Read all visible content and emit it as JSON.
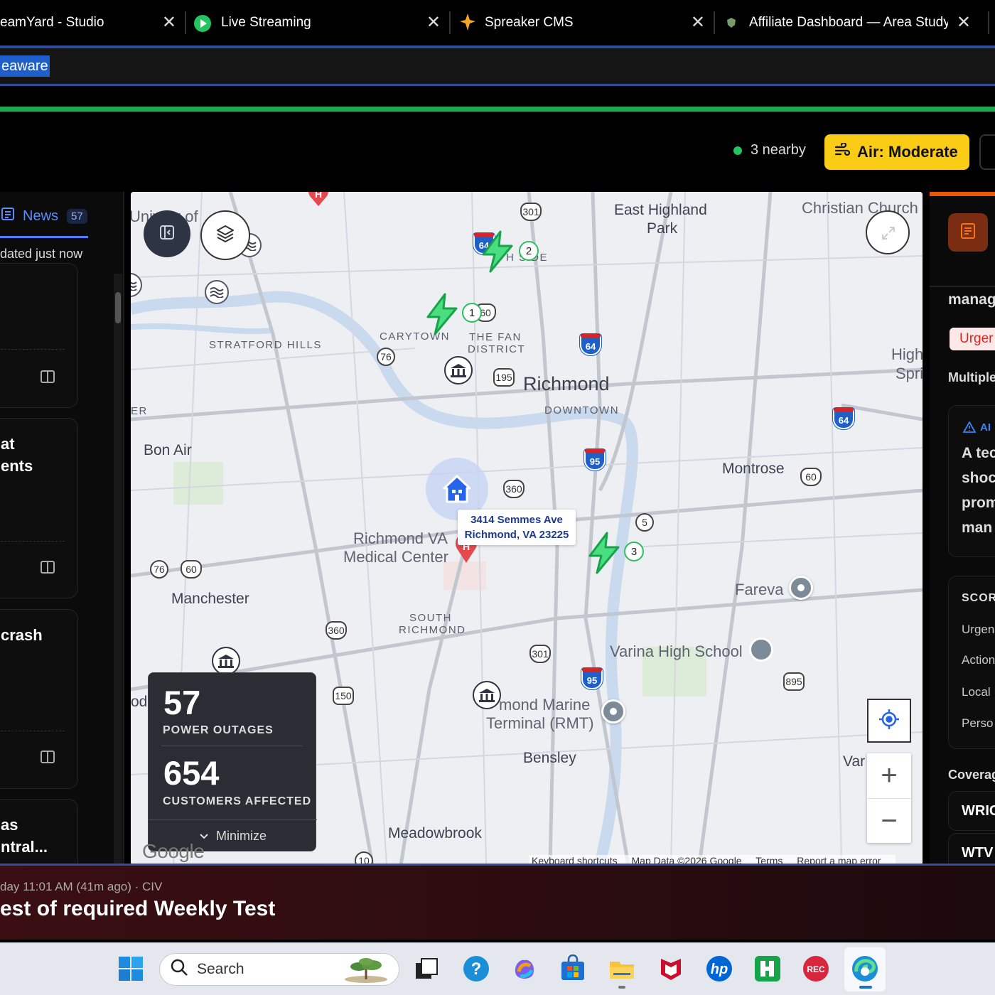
{
  "tabs": [
    {
      "title": "eamYard - Studio",
      "icon": "none"
    },
    {
      "title": "Live Streaming",
      "icon": "play-icon"
    },
    {
      "title": "Spreaker CMS",
      "icon": "star-icon"
    },
    {
      "title": "Affiliate Dashboard — Area Study",
      "icon": "shield-icon"
    }
  ],
  "address": {
    "selected_text": "eaware"
  },
  "header": {
    "nearby_text": "3 nearby",
    "air_button": "Air: Moderate",
    "colors": {
      "air": "#facc15",
      "nearby_dot": "#22c55e"
    }
  },
  "left": {
    "news_tab": "News",
    "news_count": "57",
    "updated": "dated just now",
    "cards": [
      {
        "title_lines": []
      },
      {
        "title_lines": [
          "at",
          "ents"
        ]
      },
      {
        "title_lines": [
          "crash"
        ]
      },
      {
        "title_lines": [
          "as",
          "ntral..."
        ]
      }
    ]
  },
  "map": {
    "places": {
      "east_highland_park_1": "East Highland",
      "east_highland_park_2": "Park",
      "christian_church": "Christian Church",
      "university": "Univ   ity of",
      "stratford_hills": "STRATFORD HILLS",
      "carytown": "CARYTOWN",
      "fan_district_1": "THE FAN",
      "fan_district_2": "DISTRICT",
      "richmond": "Richmond",
      "downtown": "DOWNTOWN",
      "high_springs_1": "High",
      "high_springs_2": "Spri",
      "er": "ER",
      "bon_air": "Bon Air",
      "montrose": "Montrose",
      "richmond_va_1": "Richmond VA",
      "richmond_va_2": "Medical Center",
      "manchester": "Manchester",
      "south_richmond_1": "SOUTH",
      "south_richmond_2": "RICHMOND",
      "fareva": "Fareva",
      "varina": "Varina High School",
      "marine_1": "mond Marine",
      "marine_2": "Terminal (RMT)",
      "bensley": "Bensley",
      "var": "Var",
      "meadowbrook": "Meadowbrook",
      "od": "od",
      "side": "H SIDE"
    },
    "address_line1": "3414 Semmes Ave",
    "address_line2": "Richmond, VA 23225",
    "routes": {
      "r301a": "301",
      "r64a": "64",
      "r60a": "60",
      "r76a": "76",
      "r195": "195",
      "r64b": "64",
      "r64c": "64",
      "r360a": "360",
      "r95a": "95",
      "r60b": "60",
      "r5": "5",
      "r76b": "76",
      "r60c": "60",
      "r360b": "360",
      "r301b": "301",
      "r95b": "95",
      "r895": "895",
      "r150": "150",
      "r10": "10"
    },
    "cluster_numbers": [
      "1",
      "2",
      "3"
    ],
    "outage": {
      "outages": "57",
      "outages_label": "POWER OUTAGES",
      "customers": "654",
      "customers_label": "CUSTOMERS AFFECTED",
      "minimize": "Minimize"
    },
    "google": "Google",
    "attribution": [
      "Keyboard shortcuts",
      "Map Data ©2026 Google",
      "Terms",
      "Report a map error"
    ]
  },
  "right": {
    "manag": "manag",
    "urgent": "Urger",
    "multiple": "Multiple",
    "ai_label": "AI",
    "ai_lines": [
      "A tec",
      "shoc",
      "prom",
      "man"
    ],
    "score_title": "SCOR",
    "score_items": [
      "Urgen",
      "Action",
      "Local",
      "Perso"
    ],
    "coverage": "Coverag",
    "stations": [
      "WRIC",
      "WTV"
    ]
  },
  "alert": {
    "meta": "day 11:01 AM (41m ago) · CIV",
    "title": "est of required Weekly Test"
  },
  "taskbar": {
    "search_label": "Search"
  }
}
